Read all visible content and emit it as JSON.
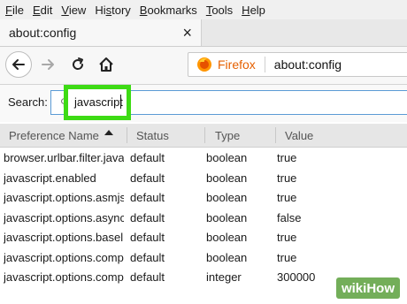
{
  "menu": [
    {
      "key": "F",
      "rest": "ile"
    },
    {
      "key": "E",
      "rest": "dit"
    },
    {
      "key": "V",
      "rest": "iew"
    },
    {
      "key": "",
      "rest": "Hi",
      "key2": "s",
      "rest2": "tory"
    },
    {
      "key": "B",
      "rest": "ookmarks"
    },
    {
      "key": "T",
      "rest": "ools"
    },
    {
      "key": "H",
      "rest": "elp"
    }
  ],
  "tab": {
    "title": "about:config",
    "close": "×"
  },
  "nav": {
    "back_icon": "arrow-left-icon",
    "forward_icon": "arrow-right-icon",
    "reload_icon": "reload-icon",
    "home_icon": "home-icon"
  },
  "urlbar": {
    "brand": "Firefox",
    "url": "about:config"
  },
  "search": {
    "label": "Search:",
    "value": "javascript"
  },
  "table": {
    "headers": {
      "name": "Preference Name",
      "status": "Status",
      "type": "Type",
      "value": "Value"
    },
    "rows": [
      {
        "name": "browser.urlbar.filter.java...",
        "status": "default",
        "type": "boolean",
        "value": "true"
      },
      {
        "name": "javascript.enabled",
        "status": "default",
        "type": "boolean",
        "value": "true"
      },
      {
        "name": "javascript.options.asmjs",
        "status": "default",
        "type": "boolean",
        "value": "true"
      },
      {
        "name": "javascript.options.asyncs...",
        "status": "default",
        "type": "boolean",
        "value": "false"
      },
      {
        "name": "javascript.options.baseli...",
        "status": "default",
        "type": "boolean",
        "value": "true"
      },
      {
        "name": "javascript.options.compa...",
        "status": "default",
        "type": "boolean",
        "value": "true"
      },
      {
        "name": "javascript.options.compa...",
        "status": "default",
        "type": "integer",
        "value": "300000"
      }
    ]
  },
  "watermark": {
    "wiki": "wiki",
    "how": "How"
  },
  "colors": {
    "highlight": "#3ddb14",
    "firefox": "#e66000"
  }
}
